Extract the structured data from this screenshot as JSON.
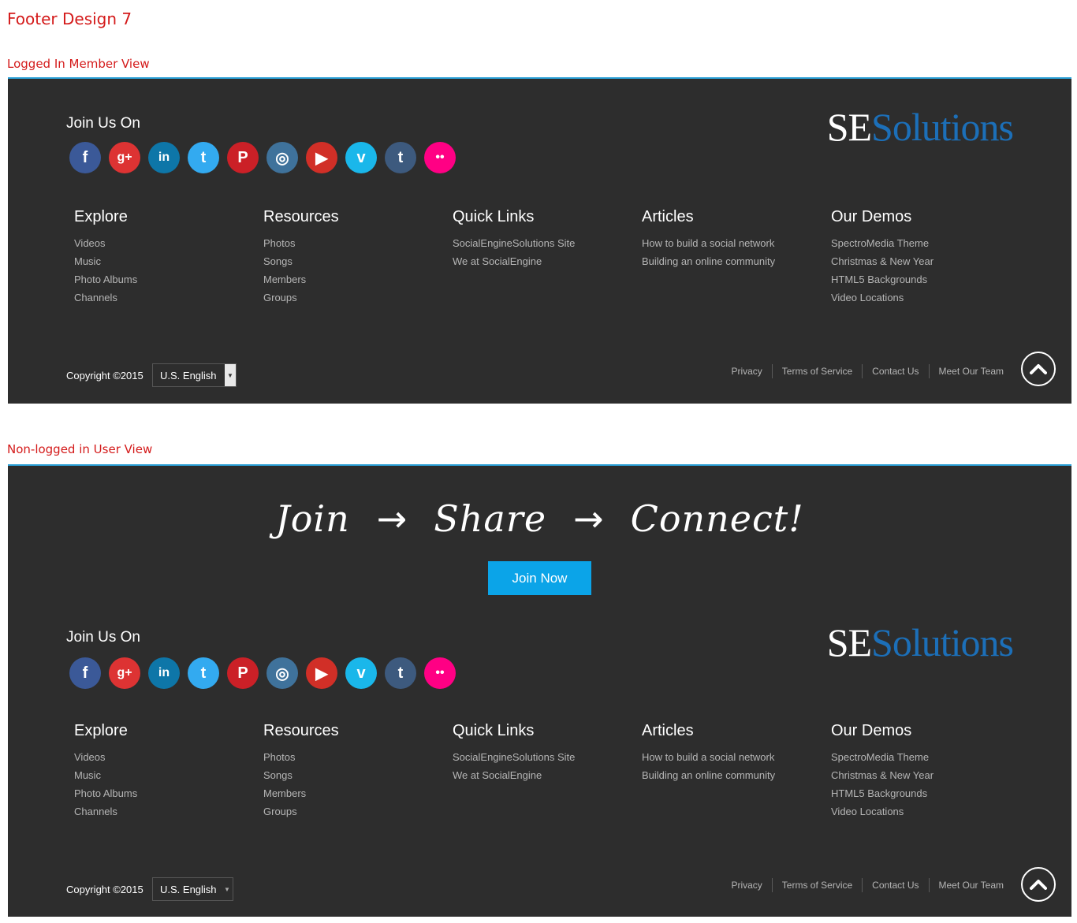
{
  "page_title": "Footer Design 7",
  "logged_in": {
    "label": "Logged In Member View",
    "join_title": "Join Us On",
    "logo": {
      "se": "SE",
      "solutions": "Solutions"
    },
    "columns": [
      {
        "title": "Explore",
        "items": [
          "Videos",
          "Music",
          "Photo Albums",
          "Channels"
        ]
      },
      {
        "title": "Resources",
        "items": [
          "Photos",
          "Songs",
          "Members",
          "Groups"
        ]
      },
      {
        "title": "Quick Links",
        "items": [
          "SocialEngineSolutions Site",
          "We at SocialEngine"
        ]
      },
      {
        "title": "Articles",
        "items": [
          "How to build a social network",
          "Building an online community"
        ]
      },
      {
        "title": "Our Demos",
        "items": [
          "SpectroMedia Theme",
          "Christmas & New Year",
          "HTML5 Backgrounds",
          "Video Locations"
        ]
      }
    ],
    "copyright": "Copyright ©2015",
    "language": "U.S. English",
    "bottom_links": [
      "Privacy",
      "Terms of Service",
      "Contact Us",
      "Meet Our Team"
    ]
  },
  "guest": {
    "label": "Non-logged in User View",
    "tagline": [
      "Join",
      "Share",
      "Connect!"
    ],
    "join_button": "Join Now",
    "join_title": "Join Us On",
    "logo": {
      "se": "SE",
      "solutions": "Solutions"
    },
    "columns": [
      {
        "title": "Explore",
        "items": [
          "Videos",
          "Music",
          "Photo Albums",
          "Channels"
        ]
      },
      {
        "title": "Resources",
        "items": [
          "Photos",
          "Songs",
          "Members",
          "Groups"
        ]
      },
      {
        "title": "Quick Links",
        "items": [
          "SocialEngineSolutions Site",
          "We at SocialEngine"
        ]
      },
      {
        "title": "Articles",
        "items": [
          "How to build a social network",
          "Building an online community"
        ]
      },
      {
        "title": "Our Demos",
        "items": [
          "SpectroMedia Theme",
          "Christmas & New Year",
          "HTML5 Backgrounds",
          "Video Locations"
        ]
      }
    ],
    "copyright": "Copyright ©2015",
    "language": "U.S. English",
    "bottom_links": [
      "Privacy",
      "Terms of Service",
      "Contact Us",
      "Meet Our Team"
    ]
  },
  "social_icons": [
    {
      "name": "facebook-icon",
      "glyph": "f",
      "color": "#3b5998"
    },
    {
      "name": "google-plus-icon",
      "glyph": "g+",
      "color": "#dd3333"
    },
    {
      "name": "linkedin-icon",
      "glyph": "in",
      "color": "#0e76a8"
    },
    {
      "name": "twitter-icon",
      "glyph": "t",
      "color": "#33aaf0"
    },
    {
      "name": "pinterest-icon",
      "glyph": "P",
      "color": "#cb2027"
    },
    {
      "name": "instagram-icon",
      "glyph": "◎",
      "color": "#3f729b"
    },
    {
      "name": "youtube-icon",
      "glyph": "▶",
      "color": "#d12f27"
    },
    {
      "name": "vimeo-icon",
      "glyph": "v",
      "color": "#1ab7ea"
    },
    {
      "name": "tumblr-icon",
      "glyph": "t",
      "color": "#3d5a7e"
    },
    {
      "name": "flickr-icon",
      "glyph": "••",
      "color": "#ff0084"
    }
  ]
}
